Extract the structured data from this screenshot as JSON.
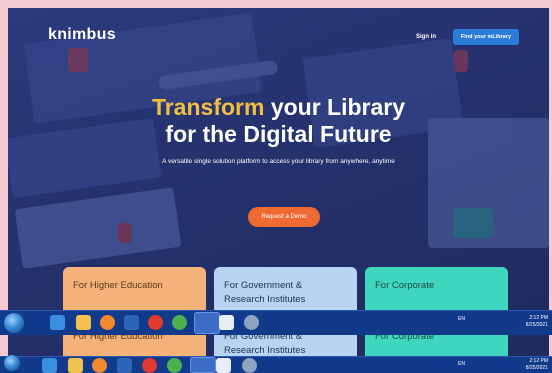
{
  "header": {
    "logo": "knimbus",
    "sign_in": "Sign in",
    "find_button": "Find your mLibrary"
  },
  "hero": {
    "headline_accent": "Transform",
    "headline_rest": " your Library",
    "headline_line2": "for the Digital Future",
    "subtitle": "A versatile single solution platform to access your library from anywhere, anytime",
    "demo_button": "Request a Demo"
  },
  "segments": [
    {
      "line1": "For Higher Education",
      "line2": "",
      "color": "#f3b27a"
    },
    {
      "line1": "For Government &",
      "line2": "Research Institutes",
      "color": "#b9d3f2"
    },
    {
      "line1": "For Corporate",
      "line2": "",
      "color": "#3fd6bf"
    }
  ],
  "taskbar": {
    "language": "EN",
    "clock_time": "2:12 PM",
    "clock_date": "8/25/2021",
    "icons": [
      "ie-icon",
      "folder-icon",
      "firefox-icon",
      "media-player-icon",
      "opera-icon",
      "chrome-icon",
      "chrome-icon",
      "document-icon",
      "paint-icon"
    ]
  },
  "colors": {
    "hero_bg": "#25326e",
    "accent_yellow": "#f2bf40",
    "demo_orange": "#ef6a33",
    "find_blue": "#2b7cd6"
  }
}
